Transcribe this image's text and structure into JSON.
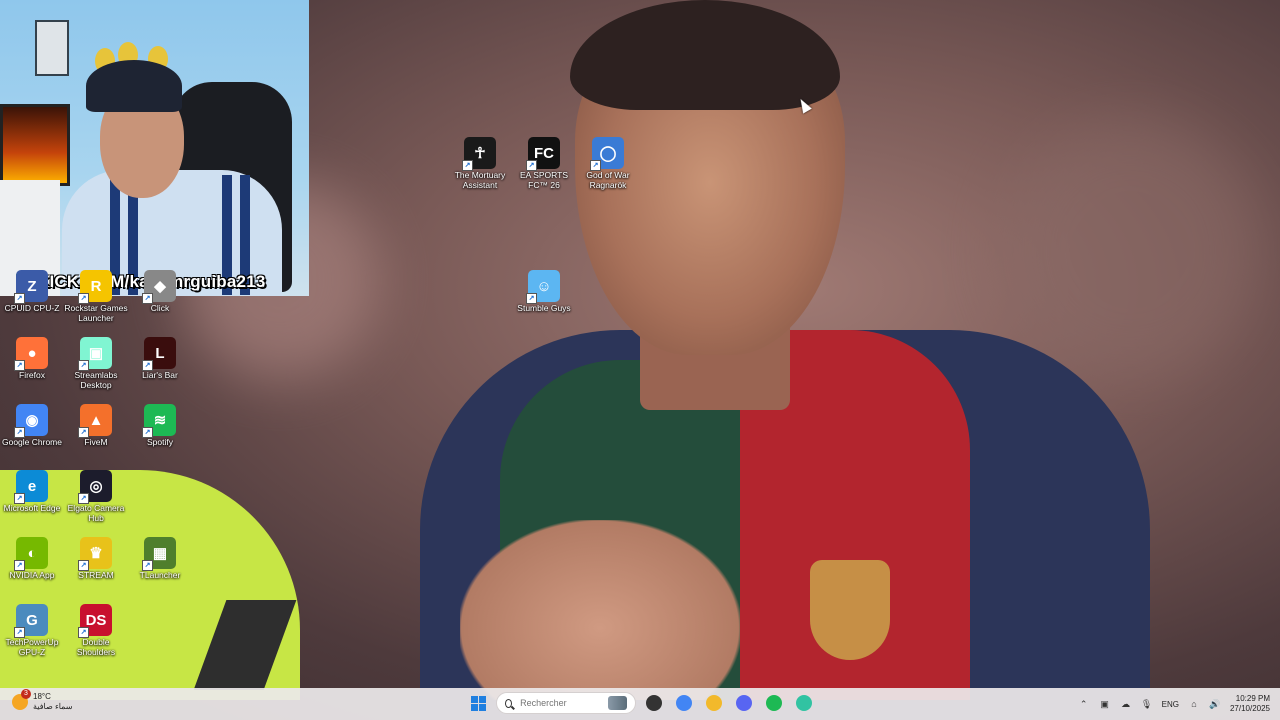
{
  "webcam": {
    "banner_text": "KICK.COM/kacemrguiba213",
    "banner_logo": "K"
  },
  "desktop_icons": [
    {
      "label": "The Mortuary Assistant",
      "icon": "mortuary-assistant-icon",
      "color": "#1a1a1a"
    },
    {
      "label": "EA SPORTS FC™ 26",
      "icon": "ea-sports-fc-icon",
      "color": "#111111"
    },
    {
      "label": "God of War Ragnarök",
      "icon": "god-of-war-icon",
      "color": "#3a7bd5"
    },
    {
      "label": "Stumble Guys",
      "icon": "stumble-guys-icon",
      "color": "#5cb6f2"
    },
    {
      "label": "CPUID CPU-Z",
      "icon": "cpuz-icon",
      "color": "#3b5ba8"
    },
    {
      "label": "Rockstar Games Launcher",
      "icon": "rockstar-icon",
      "color": "#f5c400"
    },
    {
      "label": "Click",
      "icon": "click-icon",
      "color": "#888888"
    },
    {
      "label": "Firefox",
      "icon": "firefox-icon",
      "color": "#ff7139"
    },
    {
      "label": "Streamlabs Desktop",
      "icon": "streamlabs-icon",
      "color": "#80f5d2"
    },
    {
      "label": "Liar's Bar",
      "icon": "liars-bar-icon",
      "color": "#3a0d0d"
    },
    {
      "label": "Google Chrome",
      "icon": "chrome-icon",
      "color": "#4285f4"
    },
    {
      "label": "FiveM",
      "icon": "fivem-icon",
      "color": "#f4702b"
    },
    {
      "label": "Spotify",
      "icon": "spotify-icon",
      "color": "#1db954"
    },
    {
      "label": "Microsoft Edge",
      "icon": "edge-icon",
      "color": "#0c8bd6"
    },
    {
      "label": "Elgato Camera Hub",
      "icon": "elgato-camera-icon",
      "color": "#1c1c2c"
    },
    {
      "label": "NVIDIA App",
      "icon": "nvidia-icon",
      "color": "#76b900"
    },
    {
      "label": "STREAM",
      "icon": "stream-icon",
      "color": "#e8c21a"
    },
    {
      "label": "TLauncher",
      "icon": "tlauncher-icon",
      "color": "#4f7f2c"
    },
    {
      "label": "TechPowerUp GPU-Z",
      "icon": "gpuz-icon",
      "color": "#4b8bbe"
    },
    {
      "label": "Double Shoulders",
      "icon": "double-shoulders-icon",
      "color": "#c8102e"
    }
  ],
  "taskbar": {
    "weather_temp": "18°C",
    "weather_desc": "سماء صافية",
    "weather_badge": "3",
    "search_placeholder": "Rechercher",
    "language": "ENG",
    "time": "10:29 PM",
    "date": "27/10/2025",
    "apps": [
      {
        "name": "file-manager-app-icon",
        "color": "#333333"
      },
      {
        "name": "chrome-taskbar-icon",
        "color": "#4285f4"
      },
      {
        "name": "file-explorer-icon",
        "color": "#f2b92b"
      },
      {
        "name": "discord-icon",
        "color": "#5865f2"
      },
      {
        "name": "spotify-taskbar-icon",
        "color": "#1db954"
      },
      {
        "name": "streamlabs-taskbar-icon",
        "color": "#31c3a2"
      }
    ]
  }
}
